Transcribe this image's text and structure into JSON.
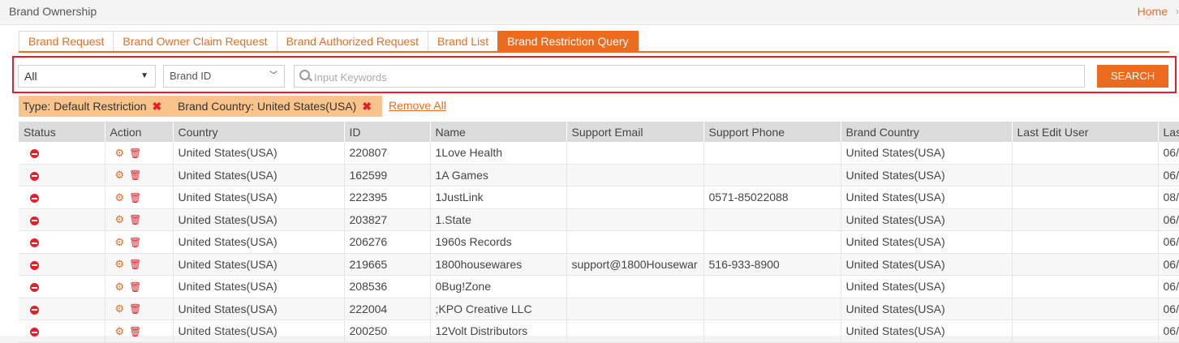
{
  "header": {
    "title": "Brand Ownership",
    "home": "Home",
    "chevron": "›"
  },
  "tabs": [
    {
      "label": "Brand Request"
    },
    {
      "label": "Brand Owner Claim Request"
    },
    {
      "label": "Brand Authorized Request"
    },
    {
      "label": "Brand List"
    },
    {
      "label": "Brand Restriction Query"
    }
  ],
  "search": {
    "type_select": "All",
    "field_select": "Brand ID",
    "placeholder": "Input Keywords",
    "button": "SEARCH"
  },
  "filters": {
    "chips": [
      "Type: Default Restriction",
      "Brand Country: United States(USA)"
    ],
    "remove_all": "Remove All"
  },
  "table": {
    "columns": [
      "Status",
      "Action",
      "Country",
      "ID",
      "Name",
      "Support Email",
      "Support Phone",
      "Brand Country",
      "Last Edit User",
      "Las"
    ],
    "rows": [
      {
        "country": "United States(USA)",
        "id": "220807",
        "name": "1Love Health",
        "email": "",
        "phone": "",
        "brand_country": "United States(USA)",
        "last_user": "",
        "last": "06/"
      },
      {
        "country": "United States(USA)",
        "id": "162599",
        "name": "1A Games",
        "email": "",
        "phone": "",
        "brand_country": "United States(USA)",
        "last_user": "",
        "last": "06/"
      },
      {
        "country": "United States(USA)",
        "id": "222395",
        "name": "1JustLink",
        "email": "",
        "phone": "0571-85022088",
        "brand_country": "United States(USA)",
        "last_user": "",
        "last": "08/"
      },
      {
        "country": "United States(USA)",
        "id": "203827",
        "name": "1.State",
        "email": "",
        "phone": "",
        "brand_country": "United States(USA)",
        "last_user": "",
        "last": "06/"
      },
      {
        "country": "United States(USA)",
        "id": "206276",
        "name": "1960s Records",
        "email": "",
        "phone": "",
        "brand_country": "United States(USA)",
        "last_user": "",
        "last": "06/"
      },
      {
        "country": "United States(USA)",
        "id": "219665",
        "name": "1800housewares",
        "email": "support@1800Housewar",
        "phone": "516-933-8900",
        "brand_country": "United States(USA)",
        "last_user": "",
        "last": "06/"
      },
      {
        "country": "United States(USA)",
        "id": "208536",
        "name": "0Bug!Zone",
        "email": "",
        "phone": "",
        "brand_country": "United States(USA)",
        "last_user": "",
        "last": "06/"
      },
      {
        "country": "United States(USA)",
        "id": "222004",
        "name": ";KPO Creative LLC",
        "email": "",
        "phone": "",
        "brand_country": "United States(USA)",
        "last_user": "",
        "last": "06/"
      },
      {
        "country": "United States(USA)",
        "id": "200250",
        "name": "12Volt Distributors",
        "email": "",
        "phone": "",
        "brand_country": "United States(USA)",
        "last_user": "",
        "last": "06/"
      }
    ]
  },
  "colors": {
    "accent": "#ec6c1f",
    "highlight_border": "#e3202a",
    "chip_bg": "#f9c48c"
  }
}
